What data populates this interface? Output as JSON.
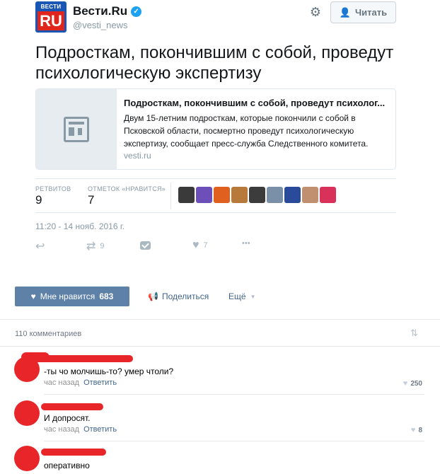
{
  "tweet": {
    "avatar": {
      "top_text": "ВЕСТИ",
      "main_text": "RU"
    },
    "account_name": "Вести.Ru",
    "handle": "@vesti_news",
    "follow_label": "Читать",
    "text": "Подросткам, покончившим с собой, проведут психологическую экспертизу",
    "card": {
      "title": "Подросткам, покончившим с собой, проведут психолог...",
      "description": "Двум 15-летним подросткам, которые покончили с собой в Псковской области, посмертно проведут психологическую экспертизу, сообщает пресс-служба Следственного комитета.",
      "domain": "vesti.ru"
    },
    "stats": {
      "retweets_label": "РЕТВИТОВ",
      "retweets": "9",
      "likes_label": "ОТМЕТОК «НРАВИТСЯ»",
      "likes": "7"
    },
    "likers": [
      "#3a3a3a",
      "#6c4fb8",
      "#e0601f",
      "#b87a3a",
      "#3c3c3c",
      "#7a8fa8",
      "#2a4a9a",
      "#c09070",
      "#d8325a"
    ],
    "timestamp": "11:20 - 14 нояб. 2016 г.",
    "actions": {
      "retweet_count": "9",
      "like_count": "7",
      "more": "•••"
    }
  },
  "vk": {
    "like_label": "Мне нравится",
    "like_count": "683",
    "share_label": "Поделиться",
    "more_label": "Ещё",
    "comments_count": "110 комментариев",
    "comments": [
      {
        "text": "-ты чо молчишь-то? умер чтоли?",
        "time": "час назад",
        "reply": "Ответить",
        "likes": "250"
      },
      {
        "text": "И допросят.",
        "time": "час назад",
        "reply": "Ответить",
        "likes": "8"
      },
      {
        "text": "оперативно"
      }
    ]
  },
  "colors": {
    "twitter_blue": "#1da1f2",
    "vk_button": "#5e81a8",
    "vk_link": "#42648b",
    "redaction": "#e8262a"
  }
}
